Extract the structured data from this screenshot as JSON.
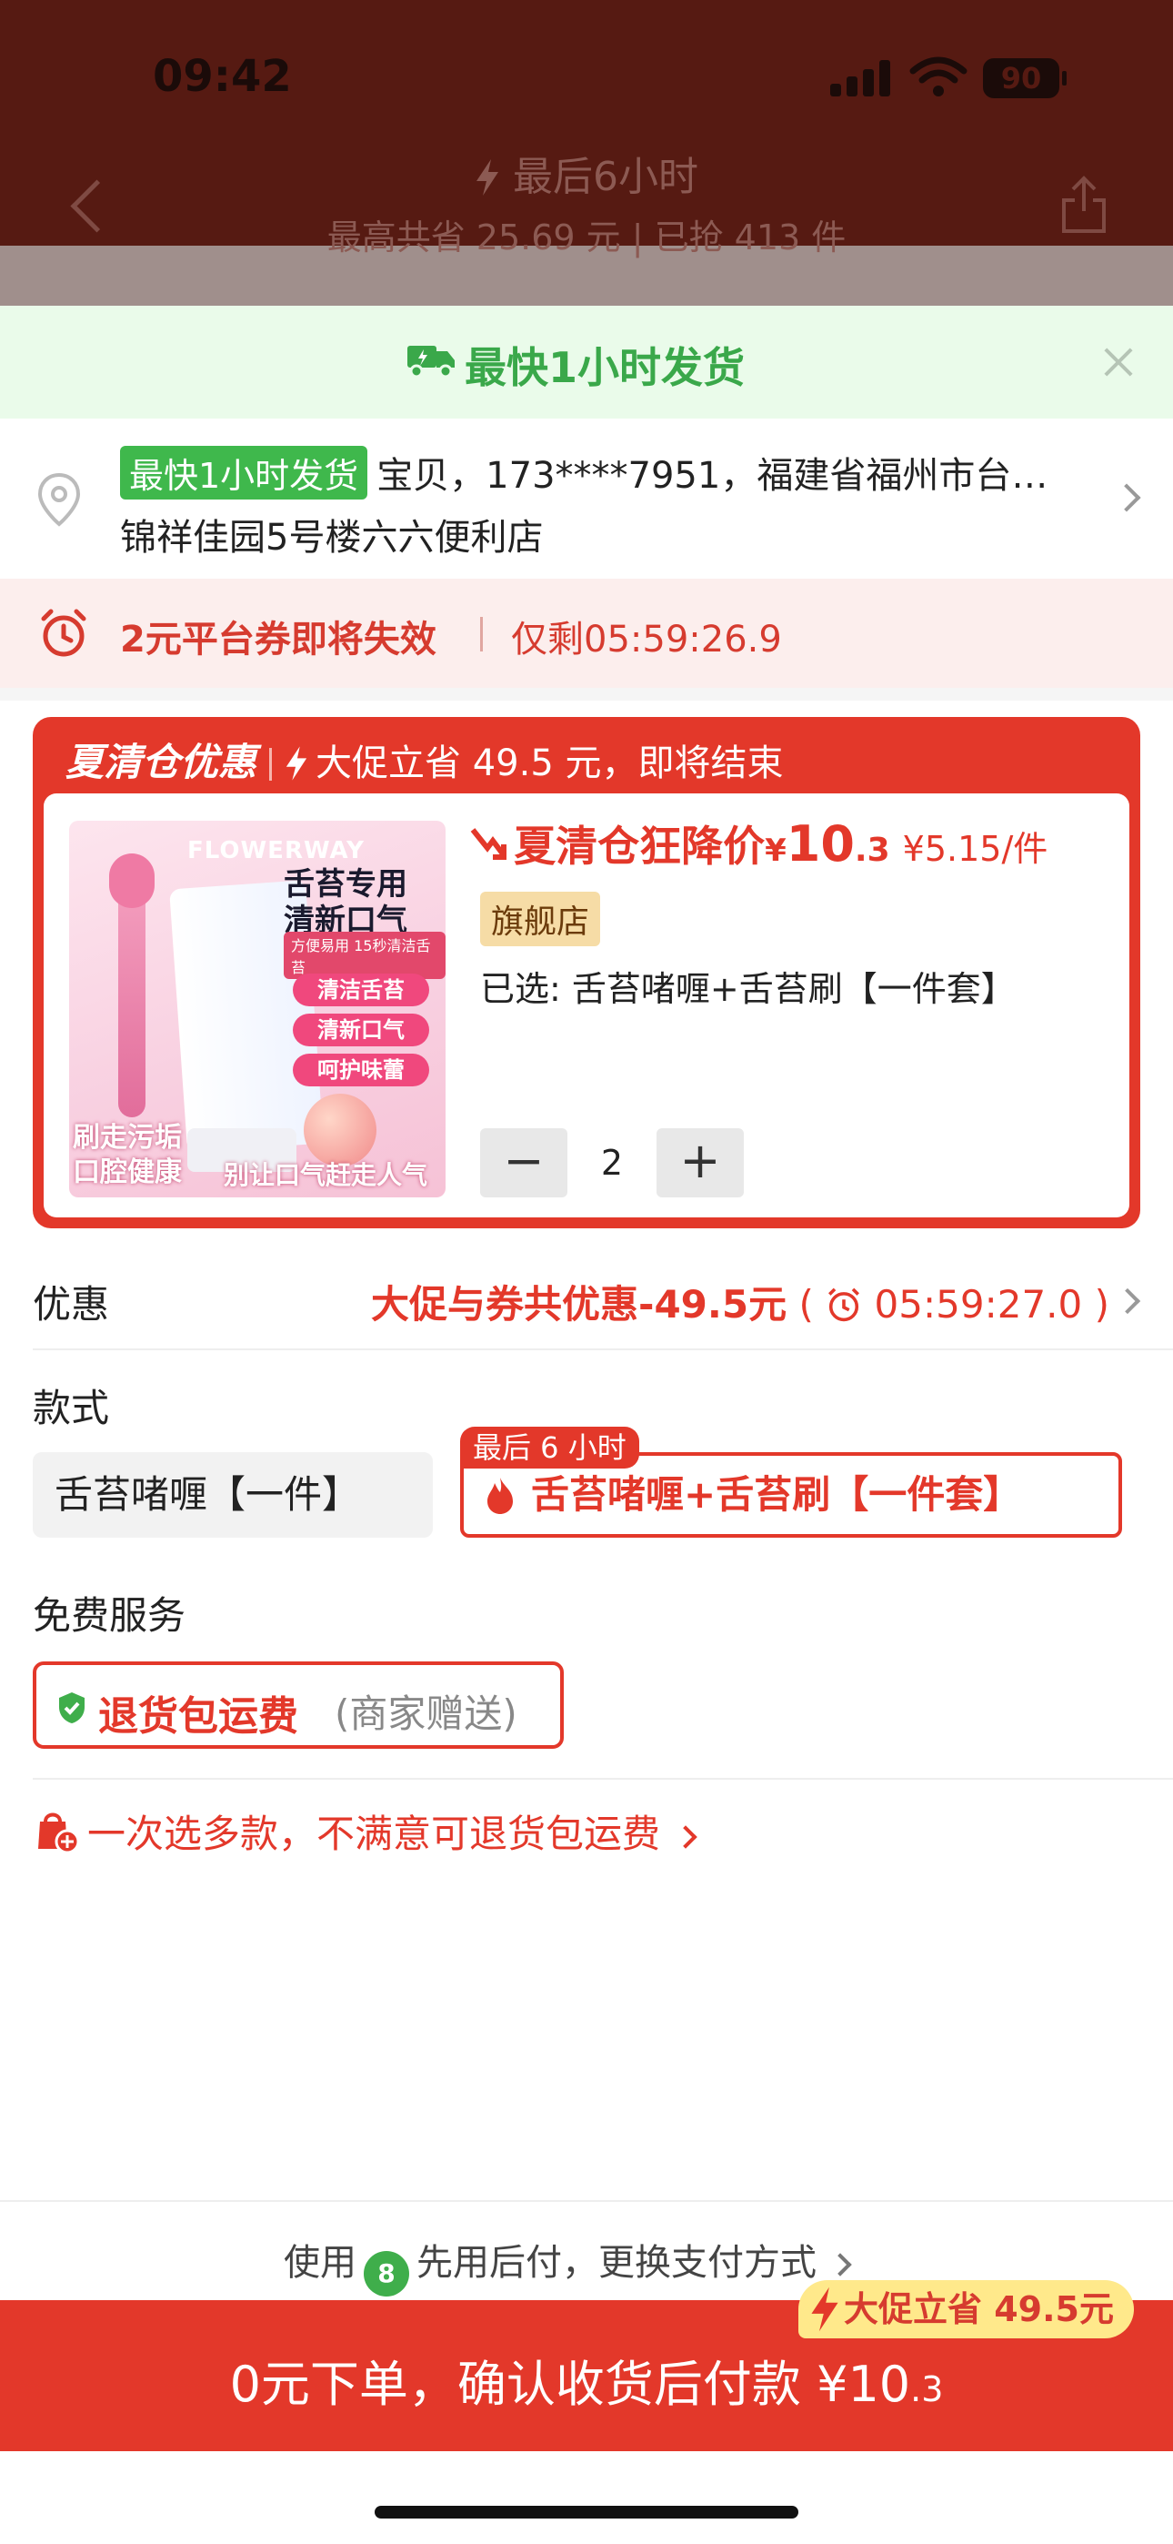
{
  "status_bar": {
    "time": "09:42",
    "battery": "90"
  },
  "header": {
    "title": "最后6小时",
    "subtitle": "最高共省 25.69 元 | 已抢 413 件"
  },
  "shipping_banner": {
    "text": "最快1小时发货"
  },
  "address": {
    "tag": "最快1小时发货",
    "line1": "宝贝，173****7951，福建省福州市台…",
    "line2": "锦祥佳园5号楼六六便利店"
  },
  "coupon_bar": {
    "main": "2元平台券即将失效",
    "remaining": "仅剩05:59:26.9"
  },
  "promo": {
    "title": "夏清仓优惠",
    "subtitle": "大促立省 49.5 元，即将结束",
    "price_label": "夏清仓狂降价",
    "price_yen": "¥",
    "price_int": "10",
    "price_dec": ".3",
    "unit_price": "¥5.15/件",
    "store_tag": "旗舰店",
    "selected": "已选: 舌苔啫喱+舌苔刷【一件套】",
    "quantity": "2",
    "minus_label": "−",
    "plus_label": "+",
    "image": {
      "brand": "FLOWERWAY",
      "headline": "舌苔专用\n清新口气",
      "sub_tag": "方便易用 15秒清洁舌苔",
      "pills": [
        "清洁舌苔",
        "清新口气",
        "呵护味蕾"
      ],
      "overlay_left": "刷走污垢\n口腔健康",
      "overlay_right": "别让口气赶走人气"
    }
  },
  "discount": {
    "label": "优惠",
    "value": "大促与券共优惠-49.5元",
    "open_paren": "(",
    "timer": "05:59:27.0",
    "close_paren": ")"
  },
  "style": {
    "label": "款式",
    "option1": "舌苔啫喱【一件】",
    "option2": "舌苔啫喱+舌苔刷【一件套】",
    "badge": "最后 6 小时"
  },
  "service": {
    "label": "免费服务",
    "main": "退货包运费",
    "note": "(商家赠送)"
  },
  "multi_select": {
    "text": "一次选多款，不满意可退货包运费"
  },
  "pay_later": {
    "prefix": "使用",
    "badge": "8",
    "text": "先用后付，更换支付方式"
  },
  "cta": {
    "badge": "大促立省 49.5元",
    "main": "0元下单，确认收货后付款 ¥10",
    "dec": ".3"
  },
  "colors": {
    "brand_red": "#e3382a",
    "green": "#3aa84a",
    "header_bg": "#561a12",
    "badge_yellow": "#ffe98b"
  }
}
